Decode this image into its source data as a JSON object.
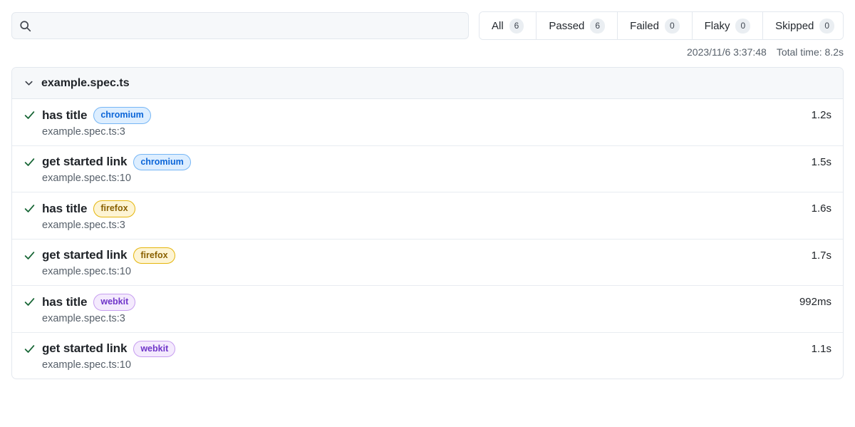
{
  "search": {
    "value": "",
    "placeholder": "",
    "icon": "search-icon"
  },
  "filters": {
    "tabs": [
      {
        "label": "All",
        "count": "6",
        "key": "all"
      },
      {
        "label": "Passed",
        "count": "6",
        "key": "passed"
      },
      {
        "label": "Failed",
        "count": "0",
        "key": "failed"
      },
      {
        "label": "Flaky",
        "count": "0",
        "key": "flaky"
      },
      {
        "label": "Skipped",
        "count": "0",
        "key": "skipped"
      }
    ]
  },
  "meta": {
    "timestamp": "2023/11/6 3:37:48",
    "total_time": "Total time: 8.2s"
  },
  "file_group": {
    "name": "example.spec.ts",
    "chevron_icon": "chevron-down-icon",
    "expanded": true
  },
  "tests": [
    {
      "status": "passed",
      "status_icon": "check-icon",
      "title": "has title",
      "project": "chromium",
      "project_class": "badge-chromium",
      "location": "example.spec.ts:3",
      "duration": "1.2s"
    },
    {
      "status": "passed",
      "status_icon": "check-icon",
      "title": "get started link",
      "project": "chromium",
      "project_class": "badge-chromium",
      "location": "example.spec.ts:10",
      "duration": "1.5s"
    },
    {
      "status": "passed",
      "status_icon": "check-icon",
      "title": "has title",
      "project": "firefox",
      "project_class": "badge-firefox",
      "location": "example.spec.ts:3",
      "duration": "1.6s"
    },
    {
      "status": "passed",
      "status_icon": "check-icon",
      "title": "get started link",
      "project": "firefox",
      "project_class": "badge-firefox",
      "location": "example.spec.ts:10",
      "duration": "1.7s"
    },
    {
      "status": "passed",
      "status_icon": "check-icon",
      "title": "has title",
      "project": "webkit",
      "project_class": "badge-webkit",
      "location": "example.spec.ts:3",
      "duration": "992ms"
    },
    {
      "status": "passed",
      "status_icon": "check-icon",
      "title": "get started link",
      "project": "webkit",
      "project_class": "badge-webkit",
      "location": "example.spec.ts:10",
      "duration": "1.1s"
    }
  ],
  "colors": {
    "pass_green": "#166534",
    "chromium_blue": "#0b65d8",
    "firefox_amber": "#8a6100",
    "webkit_purple": "#6f35c9",
    "border": "#e3e8ee",
    "header_bg": "#f6f8fa",
    "muted_text": "#57606a"
  }
}
